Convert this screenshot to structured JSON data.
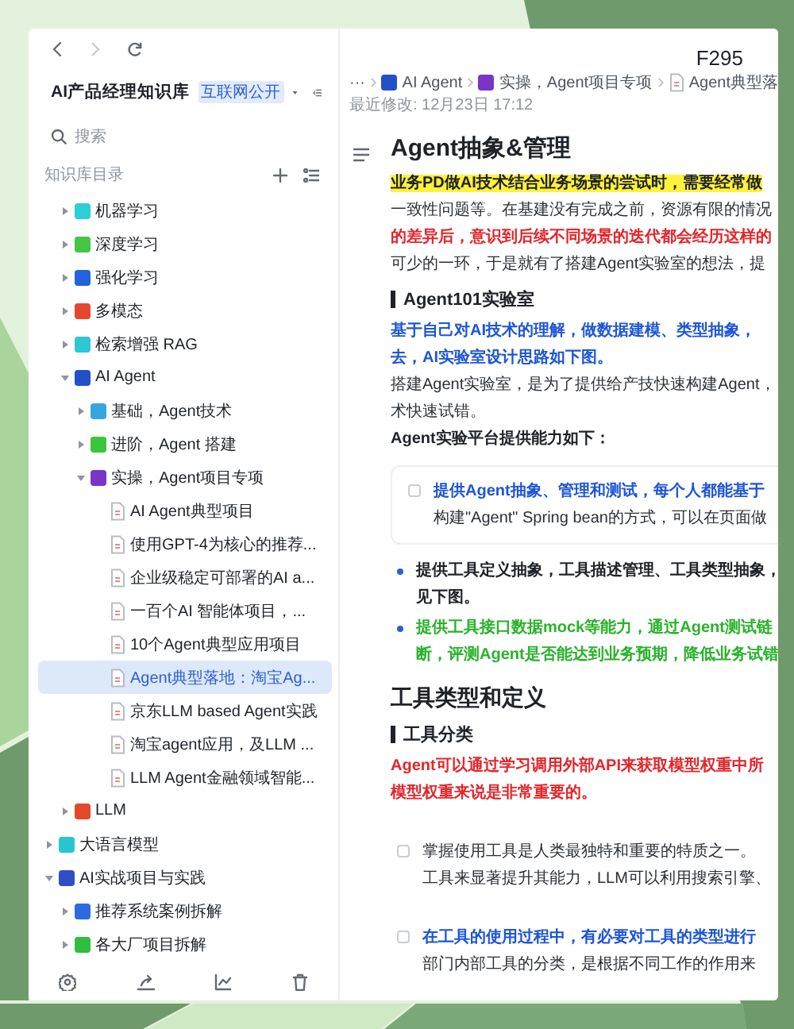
{
  "corner_label": "F295",
  "sidebar": {
    "title": "AI产品经理知识库",
    "badge": "互联网公开",
    "search": {
      "placeholder": "搜索"
    },
    "section_title": "知识库目录",
    "tree": {
      "continued": [
        {
          "label": "机器学习",
          "kind": "folder",
          "color": "#2ccfd6",
          "expanded": false,
          "selected": false
        },
        {
          "label": "深度学习",
          "kind": "folder",
          "color": "#46c443",
          "expanded": false,
          "selected": false
        },
        {
          "label": "强化学习",
          "kind": "folder",
          "color": "#2262db",
          "expanded": false,
          "selected": false
        },
        {
          "label": "多模态",
          "kind": "folder",
          "color": "#e5472c",
          "expanded": false,
          "selected": false
        },
        {
          "label": "检索增强 RAG",
          "kind": "folder",
          "color": "#2fc6d6",
          "expanded": false,
          "selected": false
        },
        {
          "label": "AI Agent",
          "kind": "folder",
          "color": "#2350c6",
          "expanded": true,
          "selected": false,
          "children": [
            {
              "label": "基础，Agent技术",
              "kind": "folder",
              "color": "#35a6e0",
              "expanded": false,
              "selected": false
            },
            {
              "label": "进阶，Agent 搭建",
              "kind": "folder",
              "color": "#3cc43a",
              "expanded": false,
              "selected": false
            },
            {
              "label": "实操，Agent项目专项",
              "kind": "folder",
              "color": "#7a34c6",
              "expanded": true,
              "selected": false,
              "children": [
                {
                  "label": "AI Agent典型项目",
                  "kind": "doc",
                  "selected": false
                },
                {
                  "label": "使用GPT-4为核心的推荐...",
                  "kind": "doc",
                  "selected": false
                },
                {
                  "label": "企业级稳定可部署的AI a...",
                  "kind": "doc",
                  "selected": false
                },
                {
                  "label": "一百个AI 智能体项目，...",
                  "kind": "doc",
                  "selected": false
                },
                {
                  "label": "10个Agent典型应用项目",
                  "kind": "doc",
                  "selected": false
                },
                {
                  "label": "Agent典型落地：淘宝Ag...",
                  "kind": "doc",
                  "selected": true
                },
                {
                  "label": "京东LLM based Agent实践",
                  "kind": "doc",
                  "selected": false
                },
                {
                  "label": "淘宝agent应用，及LLM ...",
                  "kind": "doc",
                  "selected": false
                },
                {
                  "label": "LLM Agent金融领域智能...",
                  "kind": "doc",
                  "selected": false
                }
              ]
            }
          ]
        },
        {
          "label": "LLM",
          "kind": "folder",
          "color": "#e4482a",
          "expanded": false,
          "selected": false
        }
      ],
      "items": [
        {
          "label": "大语言模型",
          "kind": "folder",
          "color": "#28c6d0",
          "expanded": false,
          "selected": false
        },
        {
          "label": "AI实战项目与实践",
          "kind": "folder",
          "color": "#2f4fc6",
          "expanded": true,
          "selected": false,
          "children": [
            {
              "label": "推荐系统案例拆解",
              "kind": "folder",
              "color": "#2a6ce0",
              "expanded": false,
              "selected": false
            },
            {
              "label": "各大厂项目拆解",
              "kind": "folder",
              "color": "#30be3e",
              "expanded": false,
              "selected": false
            }
          ]
        }
      ]
    }
  },
  "breadcrumb": [
    {
      "label": "···",
      "kind": "more"
    },
    {
      "label": "AI Agent",
      "kind": "folder",
      "color": "#2350c6"
    },
    {
      "label": "实操，Agent项目专项",
      "kind": "folder",
      "color": "#7a34c6"
    },
    {
      "label": "Agent典型落",
      "kind": "doc"
    }
  ],
  "modified": "最近修改: 12月23日 17:12",
  "blocks": [
    {
      "kind": "h1",
      "text": "Agent抽象&管理"
    },
    {
      "kind": "para",
      "lines": [
        {
          "kind": "highlight",
          "text": "业务PD做AI技术结合业务场景的尝试时，需要经常做"
        },
        {
          "kind": "plain",
          "text": "一致性问题等。在基建没有完成之前，资源有限的情况"
        },
        {
          "kind": "red",
          "text": "的差异后，意识到后续不同场景的迭代都会经历这样的"
        },
        {
          "kind": "plain",
          "text": "可少的一环，于是就有了搭建Agent实验室的想法，提"
        }
      ]
    },
    {
      "kind": "h3",
      "text": "Agent101实验室"
    },
    {
      "kind": "para",
      "lines": [
        {
          "kind": "blue",
          "text": "基于自己对AI技术的理解，做数据建模、类型抽象，"
        },
        {
          "kind": "blue",
          "text": "去，AI实验室设计思路如下图。"
        }
      ]
    },
    {
      "kind": "para",
      "lines": [
        {
          "kind": "plain",
          "text": "搭建Agent实验室，是为了提供给产技快速构建Agent，"
        },
        {
          "kind": "plain",
          "text": "术快速试错。"
        }
      ]
    },
    {
      "kind": "para",
      "lines": [
        {
          "kind": "bold",
          "text": "Agent实验平台提供能力如下："
        }
      ]
    },
    {
      "kind": "callout_todo",
      "checked": false,
      "lines": [
        {
          "kind": "blue",
          "text": "提供Agent抽象、管理和测试，每个人都能基于"
        },
        {
          "kind": "plain",
          "text": "构建\"Agent\" Spring bean的方式，可以在页面做"
        }
      ]
    },
    {
      "kind": "bullet",
      "lines": [
        {
          "kind": "bold",
          "text": "提供工具定义抽象，工具描述管理、工具类型抽象，"
        },
        {
          "kind": "bold",
          "text": "见下图。"
        }
      ]
    },
    {
      "kind": "bullet",
      "lines": [
        {
          "kind": "green",
          "text": "提供工具接口数据mock等能力，通过Agent测试链"
        },
        {
          "kind": "green",
          "text": "断，评测Agent是否能达到业务预期，降低业务试错"
        }
      ]
    },
    {
      "kind": "h2",
      "text": "工具类型和定义"
    },
    {
      "kind": "h3",
      "text": "工具分类"
    },
    {
      "kind": "para",
      "lines": [
        {
          "kind": "red",
          "text": "Agent可以通过学习调用外部API来获取模型权重中所"
        },
        {
          "kind": "red",
          "text": "模型权重来说是非常重要的。"
        }
      ]
    },
    {
      "kind": "todo",
      "checked": false,
      "lines": [
        {
          "kind": "plain",
          "text": "掌握使用工具是人类最独特和重要的特质之一。"
        },
        {
          "kind": "plain",
          "text": "工具来显著提升其能力，LLM可以利用搜索引擎、"
        }
      ]
    },
    {
      "kind": "todo",
      "checked": false,
      "lines": [
        {
          "kind": "blue",
          "text": "在工具的使用过程中，有必要对工具的类型进行"
        },
        {
          "kind": "plain",
          "text": "部门内部工具的分类，是根据不同工作的作用来"
        }
      ]
    }
  ]
}
